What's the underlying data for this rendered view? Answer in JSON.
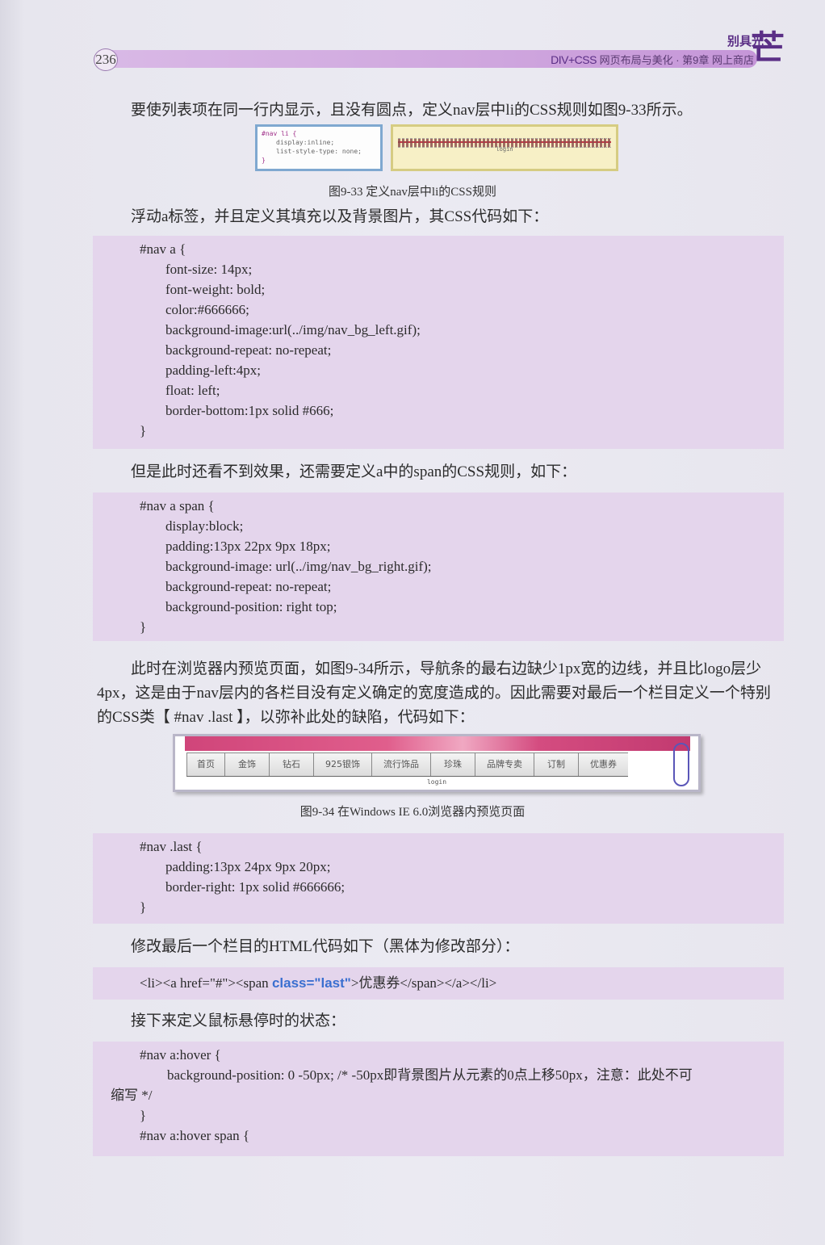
{
  "header": {
    "page_number": "236",
    "brand": "DIV+CSS",
    "title": " 网页布局与美化 · 第9章   网上商店",
    "logo_small": "别具光",
    "logo_big": "芒"
  },
  "paragraphs": {
    "p1": "要使列表项在同一行内显示，且没有圆点，定义nav层中li的CSS规则如图9-33所示。",
    "p2": "浮动a标签，并且定义其填充以及背景图片，其CSS代码如下：",
    "p3": "但是此时还看不到效果，还需要定义a中的span的CSS规则，如下：",
    "p4": "此时在浏览器内预览页面，如图9-34所示，导航条的最右边缺少1px宽的边线，并且比logo层少4px，这是由于nav层内的各栏目没有定义确定的宽度造成的。因此需要对最后一个栏目定义一个特别的CSS类【 #nav .last 】，以弥补此处的缺陷，代码如下：",
    "p5": "修改最后一个栏目的HTML代码如下（黑体为修改部分）：",
    "p6": "接下来定义鼠标悬停时的状态："
  },
  "figures": {
    "fig33_caption": "图9-33    定义nav层中li的CSS规则",
    "fig33_code": [
      "#nav li {",
      "display:inline;",
      "list-style-type: none;",
      "}"
    ],
    "fig33_login": "login",
    "fig34_caption": "图9-34    在Windows IE 6.0浏览器内预览页面",
    "fig34_nav": [
      "首页",
      "金饰",
      "钻石",
      "925银饰",
      "流行饰品",
      "珍珠",
      "品牌专卖",
      "订制",
      "优惠券"
    ],
    "fig34_login": "login"
  },
  "code_blocks": {
    "nav_a": [
      "#nav a {",
      "font-size: 14px;",
      "font-weight: bold;",
      "color:#666666;",
      "background-image:url(../img/nav_bg_left.gif);",
      "background-repeat: no-repeat;",
      "padding-left:4px;",
      "float: left;",
      "border-bottom:1px solid #666;",
      "}"
    ],
    "nav_a_span": [
      "#nav a span {",
      "display:block;",
      "padding:13px 22px 9px 18px;",
      "background-image: url(../img/nav_bg_right.gif);",
      "background-repeat: no-repeat;",
      "background-position: right top;",
      "}"
    ],
    "nav_last": [
      "#nav .last {",
      "padding:13px 24px 9px 20px;",
      "border-right: 1px solid #666666;",
      "}"
    ],
    "html_line": {
      "before": "<li><a href=\"#\"><span ",
      "bold": "class=\"last\"",
      "after": ">优惠券</span></a></li>"
    },
    "hover": [
      "#nav a:hover {",
      "background-position: 0 -50px; /* -50px即背景图片从元素的0点上移50px，注意：此处不可",
      "缩写 */",
      "}",
      "#nav a:hover span {"
    ]
  }
}
